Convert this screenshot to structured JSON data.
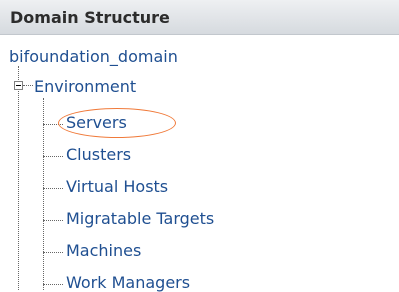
{
  "header": {
    "title": "Domain Structure"
  },
  "tree": {
    "root": "bifoundation_domain",
    "environment": {
      "label": "Environment",
      "children": [
        "Servers",
        "Clusters",
        "Virtual Hosts",
        "Migratable Targets",
        "Machines",
        "Work Managers"
      ]
    }
  },
  "colors": {
    "link": "#1f4f91",
    "highlight_circle": "#f07a3a",
    "header_bg": "#d6dadf"
  }
}
